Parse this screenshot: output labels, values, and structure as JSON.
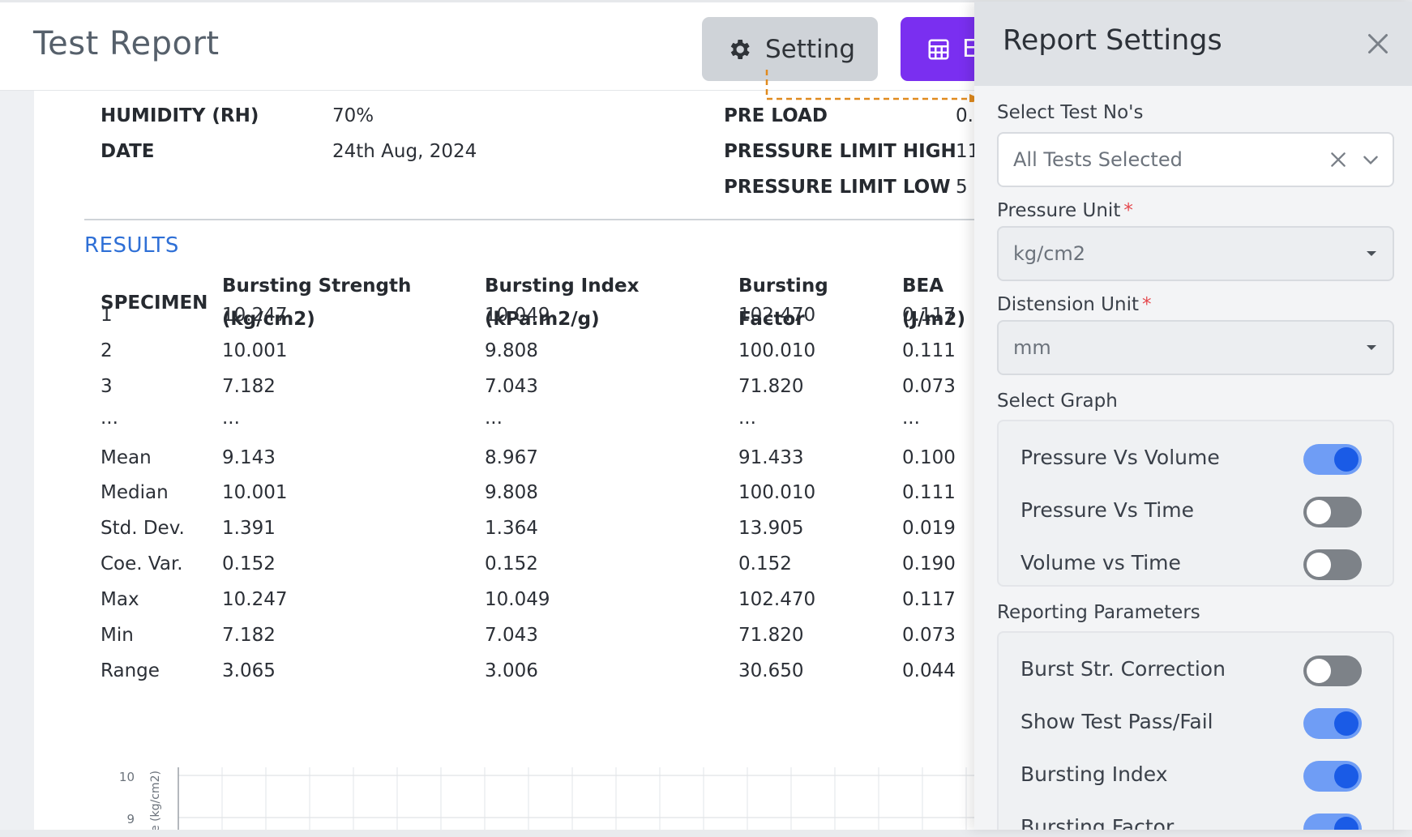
{
  "header": {
    "title": "Test Report",
    "setting_label": "Setting",
    "export_label": "E"
  },
  "meta": {
    "humidity_label": "HUMIDITY (RH)",
    "humidity_value": "70%",
    "date_label": "DATE",
    "date_value": "24th Aug, 2024",
    "preload_label": "PRE LOAD",
    "preload_value": "0.",
    "plh_label": "PRESSURE LIMIT HIGH",
    "plh_value": "11",
    "pll_label": "PRESSURE LIMIT LOW",
    "pll_value": "5"
  },
  "results": {
    "title": "RESULTS",
    "headers": {
      "specimen": "SPECIMEN",
      "bs1": "Bursting Strength",
      "bs2": "(kg/cm2)",
      "bi1": "Bursting Index",
      "bi2": "(kPa.m2/g)",
      "bf1": "Bursting",
      "bf2": "Factor",
      "bea1": "BEA",
      "bea2": "(J/m2)"
    },
    "rows": [
      [
        "1",
        "10.247",
        "10.049",
        "102.470",
        "0.117"
      ],
      [
        "2",
        "10.001",
        "9.808",
        "100.010",
        "0.111"
      ],
      [
        "3",
        "7.182",
        "7.043",
        "71.820",
        "0.073"
      ],
      [
        "...",
        "...",
        "...",
        "...",
        "..."
      ],
      [
        "Mean",
        "9.143",
        "8.967",
        "91.433",
        "0.100"
      ],
      [
        "Median",
        "10.001",
        "9.808",
        "100.010",
        "0.111"
      ],
      [
        "Std. Dev.",
        "1.391",
        "1.364",
        "13.905",
        "0.019"
      ],
      [
        "Coe. Var.",
        "0.152",
        "0.152",
        "0.152",
        "0.190"
      ],
      [
        "Max",
        "10.247",
        "10.049",
        "102.470",
        "0.117"
      ],
      [
        "Min",
        "7.182",
        "7.043",
        "71.820",
        "0.073"
      ],
      [
        "Range",
        "3.065",
        "3.006",
        "30.650",
        "0.044"
      ]
    ]
  },
  "chart": {
    "ticks": [
      "10",
      "9"
    ],
    "ylabel": "e (kg/cm2)"
  },
  "panel": {
    "title": "Report Settings",
    "select_tests_label": "Select Test No's",
    "select_tests_value": "All Tests Selected",
    "pressure_unit_label": "Pressure Unit",
    "pressure_unit_value": "kg/cm2",
    "distension_unit_label": "Distension Unit",
    "distension_unit_value": "mm",
    "required_mark": "*",
    "select_graph_label": "Select Graph",
    "graphs": [
      {
        "label": "Pressure Vs Volume",
        "on": true
      },
      {
        "label": "Pressure Vs Time",
        "on": false
      },
      {
        "label": "Volume vs Time",
        "on": false
      }
    ],
    "reporting_label": "Reporting Parameters",
    "params": [
      {
        "label": "Burst Str. Correction",
        "on": false
      },
      {
        "label": "Show Test Pass/Fail",
        "on": true
      },
      {
        "label": "Bursting Index",
        "on": true
      },
      {
        "label": "Bursting Factor",
        "on": true
      }
    ]
  },
  "colors": {
    "accent_purple": "#7a2ff0",
    "results_blue": "#2e6fd6",
    "toggle_on": "#1a5be6",
    "connector_orange": "#e08a1e"
  }
}
